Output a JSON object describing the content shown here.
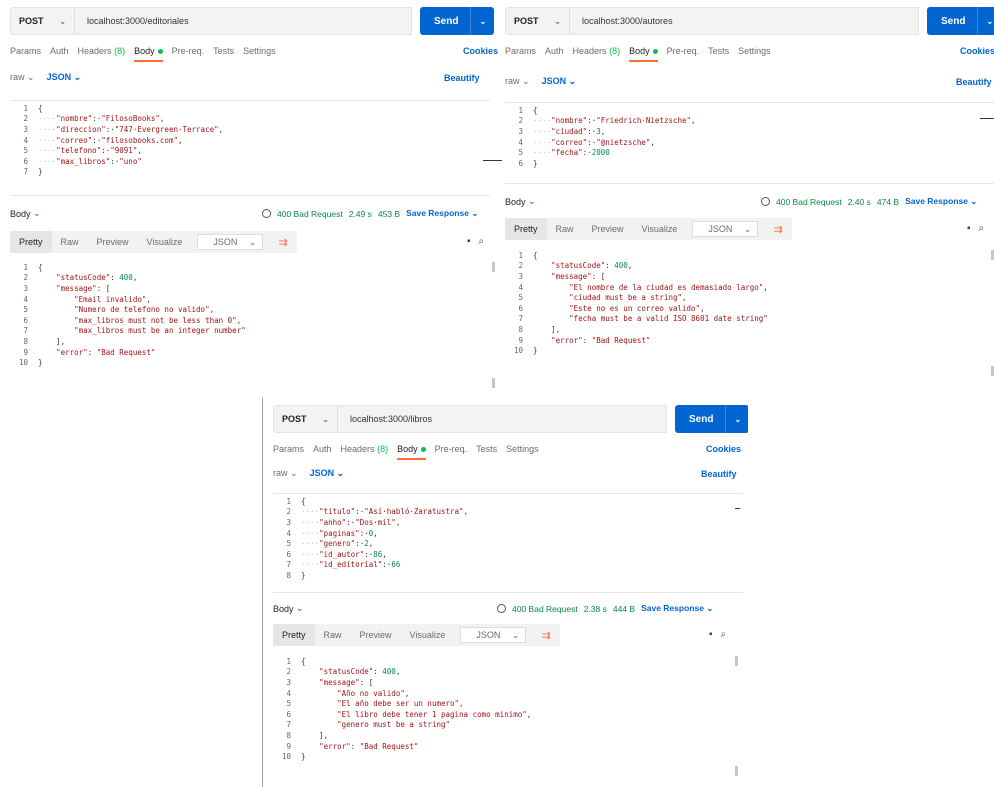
{
  "panels": [
    {
      "method": "POST",
      "url": "localhost:3000/editoriales",
      "send_label": "Send",
      "tabs": [
        "Params",
        "Auth",
        "Headers",
        "(8)",
        "Body",
        "Pre-req.",
        "Tests",
        "Settings"
      ],
      "cookies_label": "Cookies",
      "raw_label": "raw",
      "json_label": "JSON",
      "beautify_label": "Beautify",
      "request_lines": [
        [
          {
            "t": "{",
            "c": "pun"
          }
        ],
        [
          {
            "t": "····",
            "c": "ws"
          },
          {
            "t": "\"nombre\"",
            "c": "key"
          },
          {
            "t": ":·",
            "c": "pun"
          },
          {
            "t": "\"FilosoBooks\"",
            "c": "str"
          },
          {
            "t": ",",
            "c": "pun"
          }
        ],
        [
          {
            "t": "····",
            "c": "ws"
          },
          {
            "t": "\"direccion\"",
            "c": "key"
          },
          {
            "t": ":·",
            "c": "pun"
          },
          {
            "t": "\"747·Evergreen·Terrace\"",
            "c": "str"
          },
          {
            "t": ",",
            "c": "pun"
          }
        ],
        [
          {
            "t": "····",
            "c": "ws"
          },
          {
            "t": "\"correo\"",
            "c": "key"
          },
          {
            "t": ":·",
            "c": "pun"
          },
          {
            "t": "\"filosobooks.com\"",
            "c": "str"
          },
          {
            "t": ",",
            "c": "pun"
          }
        ],
        [
          {
            "t": "····",
            "c": "ws"
          },
          {
            "t": "\"telefono\"",
            "c": "key"
          },
          {
            "t": ":·",
            "c": "pun"
          },
          {
            "t": "\"9091\"",
            "c": "str"
          },
          {
            "t": ",",
            "c": "pun"
          }
        ],
        [
          {
            "t": "····",
            "c": "ws"
          },
          {
            "t": "\"max_libros\"",
            "c": "key"
          },
          {
            "t": ":·",
            "c": "pun"
          },
          {
            "t": "\"uno\"",
            "c": "str"
          }
        ],
        [
          {
            "t": "}",
            "c": "pun"
          }
        ]
      ],
      "body_label": "Body",
      "status": "400 Bad Request",
      "time": "2.49 s",
      "size": "453 B",
      "save_label": "Save Response",
      "resp_tabs": [
        "Pretty",
        "Raw",
        "Preview",
        "Visualize"
      ],
      "resp_format": "JSON",
      "response_lines": [
        [
          {
            "t": "{",
            "c": "pun"
          }
        ],
        [
          {
            "t": "    ",
            "c": "pun"
          },
          {
            "t": "\"statusCode\"",
            "c": "key"
          },
          {
            "t": ": ",
            "c": "pun"
          },
          {
            "t": "400",
            "c": "num"
          },
          {
            "t": ",",
            "c": "pun"
          }
        ],
        [
          {
            "t": "    ",
            "c": "pun"
          },
          {
            "t": "\"message\"",
            "c": "key"
          },
          {
            "t": ": [",
            "c": "pun"
          }
        ],
        [
          {
            "t": "        ",
            "c": "pun"
          },
          {
            "t": "\"Email invalido\"",
            "c": "str"
          },
          {
            "t": ",",
            "c": "pun"
          }
        ],
        [
          {
            "t": "        ",
            "c": "pun"
          },
          {
            "t": "\"Numero de telefono no valido\"",
            "c": "str"
          },
          {
            "t": ",",
            "c": "pun"
          }
        ],
        [
          {
            "t": "        ",
            "c": "pun"
          },
          {
            "t": "\"max_libros must not be less than 0\"",
            "c": "str"
          },
          {
            "t": ",",
            "c": "pun"
          }
        ],
        [
          {
            "t": "        ",
            "c": "pun"
          },
          {
            "t": "\"max_libros must be an integer number\"",
            "c": "str"
          }
        ],
        [
          {
            "t": "    ],",
            "c": "pun"
          }
        ],
        [
          {
            "t": "    ",
            "c": "pun"
          },
          {
            "t": "\"error\"",
            "c": "key"
          },
          {
            "t": ": ",
            "c": "pun"
          },
          {
            "t": "\"Bad Request\"",
            "c": "str"
          }
        ],
        [
          {
            "t": "}",
            "c": "pun"
          }
        ]
      ]
    },
    {
      "method": "POST",
      "url": "localhost:3000/autores",
      "send_label": "Send",
      "tabs": [
        "Params",
        "Auth",
        "Headers",
        "(8)",
        "Body",
        "Pre-req.",
        "Tests",
        "Settings"
      ],
      "cookies_label": "Cookies",
      "raw_label": "raw",
      "json_label": "JSON",
      "beautify_label": "Beautify",
      "request_lines": [
        [
          {
            "t": "{",
            "c": "pun"
          }
        ],
        [
          {
            "t": "····",
            "c": "ws"
          },
          {
            "t": "\"nombre\"",
            "c": "key"
          },
          {
            "t": ":·",
            "c": "pun"
          },
          {
            "t": "\"Friedrich·Nietzsche\"",
            "c": "str"
          },
          {
            "t": ",",
            "c": "pun"
          }
        ],
        [
          {
            "t": "····",
            "c": "ws"
          },
          {
            "t": "\"ciudad\"",
            "c": "key"
          },
          {
            "t": ":·",
            "c": "pun"
          },
          {
            "t": "3",
            "c": "num"
          },
          {
            "t": ",",
            "c": "pun"
          }
        ],
        [
          {
            "t": "····",
            "c": "ws"
          },
          {
            "t": "\"correo\"",
            "c": "key"
          },
          {
            "t": ":·",
            "c": "pun"
          },
          {
            "t": "\"@nietzsche\"",
            "c": "str"
          },
          {
            "t": ",",
            "c": "pun"
          }
        ],
        [
          {
            "t": "····",
            "c": "ws"
          },
          {
            "t": "\"fecha\"",
            "c": "key"
          },
          {
            "t": ":·",
            "c": "pun"
          },
          {
            "t": "2000",
            "c": "num"
          }
        ],
        [
          {
            "t": "}",
            "c": "pun"
          }
        ]
      ],
      "body_label": "Body",
      "status": "400 Bad Request",
      "time": "2.40 s",
      "size": "474 B",
      "save_label": "Save Response",
      "resp_tabs": [
        "Pretty",
        "Raw",
        "Preview",
        "Visualize"
      ],
      "resp_format": "JSON",
      "response_lines": [
        [
          {
            "t": "{",
            "c": "pun"
          }
        ],
        [
          {
            "t": "    ",
            "c": "pun"
          },
          {
            "t": "\"statusCode\"",
            "c": "key"
          },
          {
            "t": ": ",
            "c": "pun"
          },
          {
            "t": "400",
            "c": "num"
          },
          {
            "t": ",",
            "c": "pun"
          }
        ],
        [
          {
            "t": "    ",
            "c": "pun"
          },
          {
            "t": "\"message\"",
            "c": "key"
          },
          {
            "t": ": [",
            "c": "pun"
          }
        ],
        [
          {
            "t": "        ",
            "c": "pun"
          },
          {
            "t": "\"El nombre de la ciudad es demasiado largo\"",
            "c": "str"
          },
          {
            "t": ",",
            "c": "pun"
          }
        ],
        [
          {
            "t": "        ",
            "c": "pun"
          },
          {
            "t": "\"ciudad must be a string\"",
            "c": "str"
          },
          {
            "t": ",",
            "c": "pun"
          }
        ],
        [
          {
            "t": "        ",
            "c": "pun"
          },
          {
            "t": "\"Este no es un correo valido\"",
            "c": "str"
          },
          {
            "t": ",",
            "c": "pun"
          }
        ],
        [
          {
            "t": "        ",
            "c": "pun"
          },
          {
            "t": "\"fecha must be a valid ISO 8601 date string\"",
            "c": "str"
          }
        ],
        [
          {
            "t": "    ],",
            "c": "pun"
          }
        ],
        [
          {
            "t": "    ",
            "c": "pun"
          },
          {
            "t": "\"error\"",
            "c": "key"
          },
          {
            "t": ": ",
            "c": "pun"
          },
          {
            "t": "\"Bad Request\"",
            "c": "str"
          }
        ],
        [
          {
            "t": "}",
            "c": "pun"
          }
        ]
      ]
    },
    {
      "method": "POST",
      "url": "localhost:3000/libros",
      "send_label": "Send",
      "tabs": [
        "Params",
        "Auth",
        "Headers",
        "(8)",
        "Body",
        "Pre-req.",
        "Tests",
        "Settings"
      ],
      "cookies_label": "Cookies",
      "raw_label": "raw",
      "json_label": "JSON",
      "beautify_label": "Beautify",
      "request_lines": [
        [
          {
            "t": "{",
            "c": "pun"
          }
        ],
        [
          {
            "t": "····",
            "c": "ws"
          },
          {
            "t": "\"titulo\"",
            "c": "key"
          },
          {
            "t": ":·",
            "c": "pun"
          },
          {
            "t": "\"Así·habló·Zaratustra\"",
            "c": "str"
          },
          {
            "t": ",",
            "c": "pun"
          }
        ],
        [
          {
            "t": "····",
            "c": "ws"
          },
          {
            "t": "\"anho\"",
            "c": "key"
          },
          {
            "t": ":·",
            "c": "pun"
          },
          {
            "t": "\"Dos·mil\"",
            "c": "str"
          },
          {
            "t": ",",
            "c": "pun"
          }
        ],
        [
          {
            "t": "····",
            "c": "ws"
          },
          {
            "t": "\"paginas\"",
            "c": "key"
          },
          {
            "t": ":·",
            "c": "pun"
          },
          {
            "t": "0",
            "c": "num"
          },
          {
            "t": ",",
            "c": "pun"
          }
        ],
        [
          {
            "t": "····",
            "c": "ws"
          },
          {
            "t": "\"genero\"",
            "c": "key"
          },
          {
            "t": ":·",
            "c": "pun"
          },
          {
            "t": "2",
            "c": "num"
          },
          {
            "t": ",",
            "c": "pun"
          }
        ],
        [
          {
            "t": "····",
            "c": "ws"
          },
          {
            "t": "\"id_autor\"",
            "c": "key"
          },
          {
            "t": ":·",
            "c": "pun"
          },
          {
            "t": "86",
            "c": "num"
          },
          {
            "t": ",",
            "c": "pun"
          }
        ],
        [
          {
            "t": "····",
            "c": "ws"
          },
          {
            "t": "\"id_editorial\"",
            "c": "key"
          },
          {
            "t": ":·",
            "c": "pun"
          },
          {
            "t": "66",
            "c": "num"
          }
        ],
        [
          {
            "t": "}",
            "c": "pun"
          }
        ]
      ],
      "body_label": "Body",
      "status": "400 Bad Request",
      "time": "2.38 s",
      "size": "444 B",
      "save_label": "Save Response",
      "resp_tabs": [
        "Pretty",
        "Raw",
        "Preview",
        "Visualize"
      ],
      "resp_format": "JSON",
      "response_lines": [
        [
          {
            "t": "{",
            "c": "pun"
          }
        ],
        [
          {
            "t": "    ",
            "c": "pun"
          },
          {
            "t": "\"statusCode\"",
            "c": "key"
          },
          {
            "t": ": ",
            "c": "pun"
          },
          {
            "t": "400",
            "c": "num"
          },
          {
            "t": ",",
            "c": "pun"
          }
        ],
        [
          {
            "t": "    ",
            "c": "pun"
          },
          {
            "t": "\"message\"",
            "c": "key"
          },
          {
            "t": ": [",
            "c": "pun"
          }
        ],
        [
          {
            "t": "        ",
            "c": "pun"
          },
          {
            "t": "\"Año no valido\"",
            "c": "str"
          },
          {
            "t": ",",
            "c": "pun"
          }
        ],
        [
          {
            "t": "        ",
            "c": "pun"
          },
          {
            "t": "\"El año debe ser un numero\"",
            "c": "str"
          },
          {
            "t": ",",
            "c": "pun"
          }
        ],
        [
          {
            "t": "        ",
            "c": "pun"
          },
          {
            "t": "\"El libro debe tener 1 pagina como minimo\"",
            "c": "str"
          },
          {
            "t": ",",
            "c": "pun"
          }
        ],
        [
          {
            "t": "        ",
            "c": "pun"
          },
          {
            "t": "\"genero must be a string\"",
            "c": "str"
          }
        ],
        [
          {
            "t": "    ],",
            "c": "pun"
          }
        ],
        [
          {
            "t": "    ",
            "c": "pun"
          },
          {
            "t": "\"error\"",
            "c": "key"
          },
          {
            "t": ": ",
            "c": "pun"
          },
          {
            "t": "\"Bad Request\"",
            "c": "str"
          }
        ],
        [
          {
            "t": "}",
            "c": "pun"
          }
        ]
      ]
    }
  ],
  "colors": {
    "accent": "#0265d2",
    "tab_underline": "#ff6c37",
    "status_ok_text": "#0b8a3e",
    "string": "#a31515",
    "number": "#098658"
  }
}
